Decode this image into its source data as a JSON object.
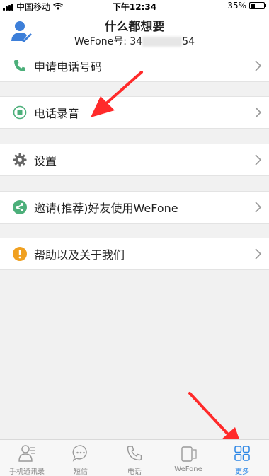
{
  "status_bar": {
    "carrier": "中国移动",
    "time": "下午12:34",
    "battery": "35%",
    "battery_level": 0.35
  },
  "header": {
    "title": "什么都想要",
    "account_prefix": "WeFone号: 34",
    "account_suffix": "54"
  },
  "menu": [
    {
      "label": "申请电话号码",
      "icon": "phone-icon"
    },
    {
      "label": "电话录音",
      "icon": "record-icon"
    },
    {
      "label": "设置",
      "icon": "gear-icon"
    },
    {
      "label": "邀请(推荐)好友使用WeFone",
      "icon": "share-icon"
    },
    {
      "label": "帮助以及关于我们",
      "icon": "info-icon"
    }
  ],
  "tabs": [
    {
      "label": "手机通讯录",
      "icon": "contacts-icon"
    },
    {
      "label": "短信",
      "icon": "message-icon"
    },
    {
      "label": "电话",
      "icon": "phone-icon"
    },
    {
      "label": "WeFone",
      "icon": "wefone-icon"
    },
    {
      "label": "更多",
      "icon": "grid-icon",
      "active": true
    }
  ],
  "colors": {
    "accent": "#2b86e6",
    "green": "#4caf7a",
    "orange": "#f0a020",
    "annotation": "#ff2a2a"
  }
}
